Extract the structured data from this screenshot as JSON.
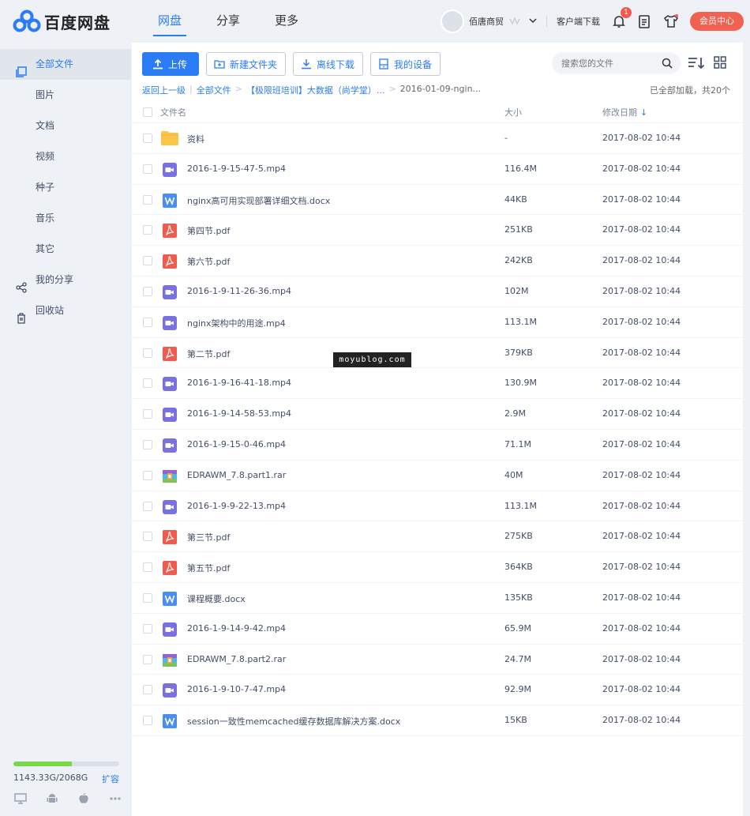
{
  "app": {
    "logo_text": "百度网盘",
    "brand_color": "#2b7cf6"
  },
  "topnav": [
    {
      "label": "网盘",
      "active": true
    },
    {
      "label": "分享",
      "active": false
    },
    {
      "label": "更多",
      "active": false
    }
  ],
  "header": {
    "username": "佰唐商贸",
    "client_download": "客户端下载",
    "notification_count": "1",
    "vip_center": "会员中心"
  },
  "sidebar": {
    "items": [
      {
        "label": "全部文件",
        "icon": "all-files-icon",
        "active": true
      },
      {
        "label": "图片",
        "icon": "",
        "active": false
      },
      {
        "label": "文档",
        "icon": "",
        "active": false
      },
      {
        "label": "视频",
        "icon": "",
        "active": false
      },
      {
        "label": "种子",
        "icon": "",
        "active": false
      },
      {
        "label": "音乐",
        "icon": "",
        "active": false
      },
      {
        "label": "其它",
        "icon": "",
        "active": false
      },
      {
        "label": "我的分享",
        "icon": "share-icon",
        "active": false
      },
      {
        "label": "回收站",
        "icon": "trash-icon",
        "active": false
      }
    ],
    "storage_used": "1143.33G/2068G",
    "storage_fraction": 0.553,
    "expand_label": "扩容"
  },
  "toolbar": {
    "upload": "上传",
    "new_folder": "新建文件夹",
    "offline_download": "离线下载",
    "my_devices": "我的设备",
    "search_placeholder": "搜索您的文件"
  },
  "breadcrumb": {
    "back": "返回上一级",
    "root": "全部文件",
    "folder": "【极限班培训】大数据（尚学堂）...",
    "current": "2016-01-09-ngin...",
    "loaded_status": "已全部加载，共20个"
  },
  "table": {
    "headers": {
      "name": "文件名",
      "size": "大小",
      "date": "修改日期"
    },
    "rows": [
      {
        "type": "folder",
        "name": "资料",
        "size": "-",
        "date": "2017-08-02 10:44"
      },
      {
        "type": "video",
        "name": "2016-1-9-15-47-5.mp4",
        "size": "116.4M",
        "date": "2017-08-02 10:44"
      },
      {
        "type": "word",
        "name": "nginx高可用实现部署详细文档.docx",
        "size": "44KB",
        "date": "2017-08-02 10:44"
      },
      {
        "type": "pdf",
        "name": "第四节.pdf",
        "size": "251KB",
        "date": "2017-08-02 10:44"
      },
      {
        "type": "pdf",
        "name": "第六节.pdf",
        "size": "242KB",
        "date": "2017-08-02 10:44"
      },
      {
        "type": "video",
        "name": "2016-1-9-11-26-36.mp4",
        "size": "102M",
        "date": "2017-08-02 10:44"
      },
      {
        "type": "video",
        "name": "nginx架构中的用途.mp4",
        "size": "113.1M",
        "date": "2017-08-02 10:44"
      },
      {
        "type": "pdf",
        "name": "第二节.pdf",
        "size": "379KB",
        "date": "2017-08-02 10:44"
      },
      {
        "type": "video",
        "name": "2016-1-9-16-41-18.mp4",
        "size": "130.9M",
        "date": "2017-08-02 10:44"
      },
      {
        "type": "video",
        "name": "2016-1-9-14-58-53.mp4",
        "size": "2.9M",
        "date": "2017-08-02 10:44"
      },
      {
        "type": "video",
        "name": "2016-1-9-15-0-46.mp4",
        "size": "71.1M",
        "date": "2017-08-02 10:44"
      },
      {
        "type": "rar",
        "name": "EDRAWM_7.8.part1.rar",
        "size": "40M",
        "date": "2017-08-02 10:44"
      },
      {
        "type": "video",
        "name": "2016-1-9-9-22-13.mp4",
        "size": "113.1M",
        "date": "2017-08-02 10:44"
      },
      {
        "type": "pdf",
        "name": "第三节.pdf",
        "size": "275KB",
        "date": "2017-08-02 10:44"
      },
      {
        "type": "pdf",
        "name": "第五节.pdf",
        "size": "364KB",
        "date": "2017-08-02 10:44"
      },
      {
        "type": "word",
        "name": "课程概要.docx",
        "size": "135KB",
        "date": "2017-08-02 10:44"
      },
      {
        "type": "video",
        "name": "2016-1-9-14-9-42.mp4",
        "size": "65.9M",
        "date": "2017-08-02 10:44"
      },
      {
        "type": "rar",
        "name": "EDRAWM_7.8.part2.rar",
        "size": "24.7M",
        "date": "2017-08-02 10:44"
      },
      {
        "type": "video",
        "name": "2016-1-9-10-7-47.mp4",
        "size": "92.9M",
        "date": "2017-08-02 10:44"
      },
      {
        "type": "word",
        "name": "session一致性memcached缓存数据库解决方案.docx",
        "size": "15KB",
        "date": "2017-08-02 10:44"
      }
    ]
  },
  "watermark": "moyublog.com"
}
